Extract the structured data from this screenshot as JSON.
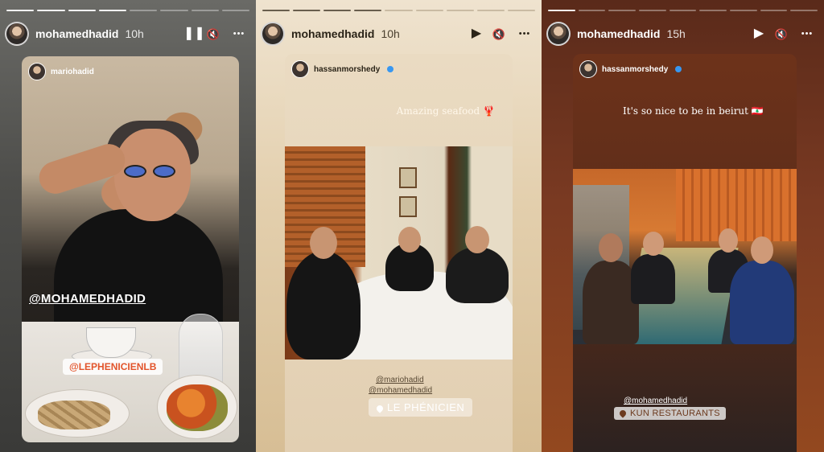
{
  "stories": [
    {
      "username": "mohamedhadid",
      "time": "10h",
      "controls": {
        "play_state": "pause",
        "play_glyph": "❚❚",
        "mute_glyph": "🔇",
        "more_glyph": "•••"
      },
      "progress_total": 8,
      "progress_done": 4,
      "card": {
        "username": "mariohadid",
        "mention": "@MOHAMEDHADID",
        "location": "@LEPHENICIENLB"
      }
    },
    {
      "username": "mohamedhadid",
      "time": "10h",
      "controls": {
        "play_state": "play",
        "play_glyph": "▶",
        "mute_glyph": "🔇",
        "more_glyph": "•••"
      },
      "progress_total": 9,
      "progress_done": 4,
      "card": {
        "username": "hassanmorshedy",
        "verified": true,
        "caption": "Amazing seafood 🦞",
        "mentions": [
          "@mariohadid",
          "@mohamedhadid"
        ],
        "location": "LE PHÉNICIEN"
      }
    },
    {
      "username": "mohamedhadid",
      "time": "15h",
      "controls": {
        "play_state": "play",
        "play_glyph": "▶",
        "mute_glyph": "🔇",
        "more_glyph": "•••"
      },
      "progress_total": 9,
      "progress_done": 1,
      "card": {
        "username": "hassanmorshedy",
        "verified": true,
        "caption": "It's so nice to be in beirut 🇱🇧",
        "mention": "@mohamedhadid",
        "location": "KUN RESTAURANTS"
      }
    }
  ],
  "colors": {
    "verified_blue": "#3897f0",
    "location_orange": "#e2542b"
  }
}
